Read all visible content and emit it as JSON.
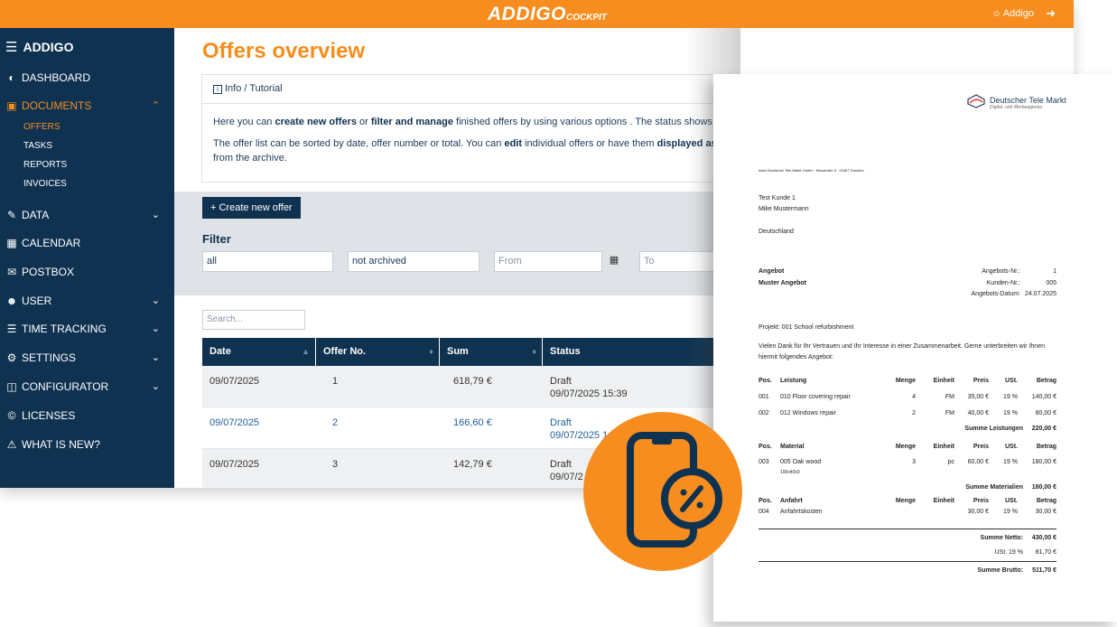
{
  "topbar": {
    "brand": "ADDIGO",
    "brand_sub": "COCKPIT",
    "user": "Addigo",
    "bg_color": "#f68d1e"
  },
  "sidebar": {
    "title": "ADDIGO",
    "items": [
      {
        "label": "DASHBOARD",
        "icon": "dashboard-icon"
      },
      {
        "label": "DOCUMENTS",
        "icon": "documents-icon",
        "active": true,
        "expanded": true
      },
      {
        "label": "DATA",
        "icon": "data-icon"
      },
      {
        "label": "CALENDAR",
        "icon": "calendar-icon"
      },
      {
        "label": "POSTBOX",
        "icon": "mail-icon"
      },
      {
        "label": "USER",
        "icon": "users-icon"
      },
      {
        "label": "TIME TRACKING",
        "icon": "list-icon"
      },
      {
        "label": "SETTINGS",
        "icon": "gear-icon"
      },
      {
        "label": "CONFIGURATOR",
        "icon": "configurator-icon"
      },
      {
        "label": "LICENSES",
        "icon": "copyright-icon"
      },
      {
        "label": "WHAT IS NEW?",
        "icon": "warning-icon"
      }
    ],
    "sub_items": [
      "OFFERS",
      "TASKS",
      "REPORTS",
      "INVOICES"
    ]
  },
  "main": {
    "title": "Offers overview",
    "info": {
      "header": "Info / Tutorial",
      "p1_a": "Here you can ",
      "p1_b": "create new offers",
      "p1_c": " or ",
      "p1_d": "filter and manage",
      "p1_e": " finished offers by using various options . The status shows wh",
      "p2_a": "The offer list can be sorted by date, offer number or total. You can ",
      "p2_b": "edit",
      "p2_c": " individual offers or have them ",
      "p2_d": "displayed as P",
      "p2_e": "from the archive."
    },
    "create_button": "+ Create new offer",
    "filter_title": "Filter",
    "filters": {
      "type": "all",
      "archive": "not archived",
      "from_placeholder": "From",
      "to_placeholder": "To"
    },
    "search_placeholder": "Search...",
    "columns": [
      "Date",
      "Offer No.",
      "Sum",
      "Status"
    ],
    "rows": [
      {
        "date": "09/07/2025",
        "no": "1",
        "sum": "618,79 €",
        "status": "Draft",
        "status_time": "09/07/2025 15:39"
      },
      {
        "date": "09/07/2025",
        "no": "2",
        "sum": "166,60 €",
        "status": "Draft",
        "status_time": "09/07/2025 1"
      },
      {
        "date": "09/07/2025",
        "no": "3",
        "sum": "142,79 €",
        "status": "Draft",
        "status_time": "09/07/2"
      }
    ]
  },
  "document": {
    "logo": "Deutscher Tele Markt",
    "logo_sub": "Digital- und Werbeagentur",
    "sender": "www Deutscher Tele Markt GmbH · Musstraße 6 · 01067 Dresden",
    "customer": [
      "Test Kunde 1",
      "Mike Mustermann",
      "Deutschland"
    ],
    "offer_label": "Angebot",
    "offer_name": "Muster Angebot",
    "meta": [
      {
        "label": "Angebots-Nr.:",
        "value": "1"
      },
      {
        "label": "Kunden-Nr.:",
        "value": "005"
      },
      {
        "label": "Angebots-Datum:",
        "value": "24.07.2025"
      }
    ],
    "project": "Projekt: 001 School refurbishment",
    "intro1": "Vielen Dank für Ihr Vertrauen und Ihr Interesse in einer Zusammenarbeit. Gerne unterbreiten wir Ihnen",
    "intro2": "hiermit folgendes Angebot:",
    "services_header": [
      "Pos.",
      "Leistung",
      "Menge",
      "Einheit",
      "Preis",
      "USt.",
      "Betrag"
    ],
    "services": [
      [
        "001",
        "010 Floor covering repair",
        "4",
        "FM",
        "35,00 €",
        "19 %",
        "140,00 €"
      ],
      [
        "002",
        "012 Windows repair",
        "2",
        "FM",
        "40,00 €",
        "19 %",
        "80,00 €"
      ]
    ],
    "services_total": [
      "Summe Leistungen",
      "220,00 €"
    ],
    "material_header": [
      "Pos.",
      "Material",
      "Menge",
      "Einheit",
      "Preis",
      "USt.",
      "Betrag"
    ],
    "material": [
      [
        "003",
        "005 Oak wood",
        "3",
        "pc",
        "60,00 €",
        "19 %",
        "180,00 €"
      ]
    ],
    "material_note": "100x40x3",
    "material_total": [
      "Summe Materialien",
      "180,00 €"
    ],
    "travel_header": [
      "Pos.",
      "Anfahrt",
      "Menge",
      "Einheit",
      "Preis",
      "USt.",
      "Betrag"
    ],
    "travel": [
      [
        "004",
        "Anfahrtskosten",
        "",
        "",
        "30,00 €",
        "19 %",
        "30,00 €"
      ]
    ],
    "net": [
      "Summe Netto:",
      "430,00 €"
    ],
    "vat": [
      "USt. 19 %",
      "81,70 €"
    ],
    "gross": [
      "Summe Brutto:",
      "511,70 €"
    ]
  },
  "badge": {
    "icon": "mobile-discount-icon",
    "color": "#f68d1e"
  }
}
